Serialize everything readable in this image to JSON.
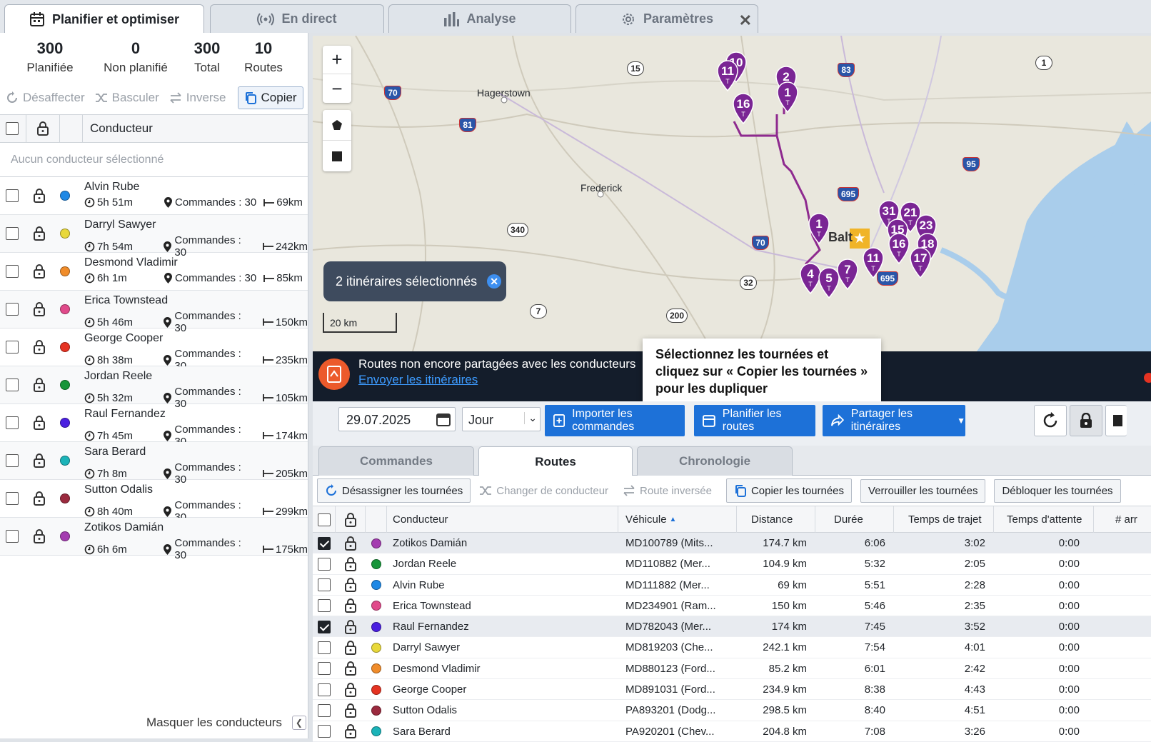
{
  "tabs": [
    {
      "label": "Planifier et optimiser",
      "icon": "calendar-icon",
      "active": true
    },
    {
      "label": "En direct",
      "icon": "broadcast-icon"
    },
    {
      "label": "Analyse",
      "icon": "bar-chart-icon"
    },
    {
      "label": "Paramètres",
      "icon": "gear-icon"
    }
  ],
  "stats": [
    {
      "value": "300",
      "label": "Planifiée"
    },
    {
      "value": "0",
      "label": "Non planifié"
    },
    {
      "value": "300",
      "label": "Total"
    },
    {
      "value": "10",
      "label": "Routes"
    }
  ],
  "left_toolbar": {
    "unassign": "Désaffecter",
    "switch": "Basculer",
    "reverse": "Inverse",
    "copy": "Copier"
  },
  "left_header": {
    "driver": "Conducteur"
  },
  "no_driver_selected": "Aucun conducteur sélectionné",
  "drivers": [
    {
      "name": "Alvin Rube",
      "color": "#1e88e5",
      "time": "5h 51m",
      "orders": "Commandes : 30",
      "distance": "69km"
    },
    {
      "name": "Darryl Sawyer",
      "color": "#e8d83a",
      "time": "7h 54m",
      "orders": "Commandes : 30",
      "distance": "242km"
    },
    {
      "name": "Desmond Vladimir",
      "color": "#f08c2a",
      "time": "6h 1m",
      "orders": "Commandes : 30",
      "distance": "85km"
    },
    {
      "name": "Erica Townstead",
      "color": "#e04a8a",
      "time": "5h 46m",
      "orders": "Commandes : 30",
      "distance": "150km"
    },
    {
      "name": "George Cooper",
      "color": "#e53322",
      "time": "8h 38m",
      "orders": "Commandes : 30",
      "distance": "235km"
    },
    {
      "name": "Jordan Reele",
      "color": "#17953a",
      "time": "5h 32m",
      "orders": "Commandes : 30",
      "distance": "105km"
    },
    {
      "name": "Raul Fernandez",
      "color": "#4a1fe0",
      "time": "7h 45m",
      "orders": "Commandes : 30",
      "distance": "174km"
    },
    {
      "name": "Sara Berard",
      "color": "#1bb3b8",
      "time": "7h 8m",
      "orders": "Commandes : 30",
      "distance": "205km"
    },
    {
      "name": "Sutton Odalis",
      "color": "#9b2a3e",
      "time": "8h 40m",
      "orders": "Commandes : 30",
      "distance": "299km"
    },
    {
      "name": "Zotikos Damián",
      "color": "#a43cb0",
      "time": "6h 6m",
      "orders": "Commandes : 30",
      "distance": "175km"
    }
  ],
  "hide_drivers": "Masquer les conducteurs",
  "map": {
    "selected_routes": "2 itinéraires sélectionnés",
    "scale": "20 km",
    "places": [
      "Hagerstown",
      "Frederick",
      "Balt"
    ],
    "highways": [
      "70",
      "81",
      "15",
      "83",
      "695",
      "340",
      "70",
      "32",
      "7",
      "200",
      "95",
      "695",
      "1"
    ],
    "pins": [
      "10",
      "11",
      "16",
      "2",
      "1",
      "1",
      "31",
      "21",
      "15",
      "23",
      "16",
      "18",
      "17",
      "11",
      "4",
      "5",
      "7"
    ],
    "pin_letter": "T"
  },
  "banner": {
    "text": "Routes non encore partagées avec les conducteurs",
    "link": "Envoyer les itinéraires"
  },
  "tooltip": "Sélectionnez les tournées et cliquez sur « Copier les tournées » pour les dupliquer",
  "controls": {
    "date": "29.07.2025",
    "period": "Jour",
    "import": "Importer les commandes",
    "plan": "Planifier les routes",
    "share": "Partager les itinéraires"
  },
  "subtabs": [
    "Commandes",
    "Routes",
    "Chronologie"
  ],
  "actions": {
    "unassign": "Désassigner les tournées",
    "change_driver": "Changer de conducteur",
    "reverse": "Route inversée",
    "copy": "Copier les tournées",
    "lock": "Verrouiller les tournées",
    "unlock": "Débloquer les tournées"
  },
  "table": {
    "headers": {
      "driver": "Conducteur",
      "vehicle": "Véhicule",
      "distance": "Distance",
      "duration": "Durée",
      "travel": "Temps de trajet",
      "wait": "Temps d'attente",
      "arrivals": "# arr"
    },
    "rows": [
      {
        "checked": true,
        "color": "#a43cb0",
        "driver": "Zotikos Damián",
        "vehicle": "MD100789 (Mits...",
        "distance": "174.7 km",
        "duration": "6:06",
        "travel": "3:02",
        "wait": "0:00"
      },
      {
        "checked": false,
        "color": "#17953a",
        "driver": "Jordan Reele",
        "vehicle": "MD110882 (Mer...",
        "distance": "104.9 km",
        "duration": "5:32",
        "travel": "2:05",
        "wait": "0:00"
      },
      {
        "checked": false,
        "color": "#1e88e5",
        "driver": "Alvin Rube",
        "vehicle": "MD111882 (Mer...",
        "distance": "69 km",
        "duration": "5:51",
        "travel": "2:28",
        "wait": "0:00"
      },
      {
        "checked": false,
        "color": "#e04a8a",
        "driver": "Erica Townstead",
        "vehicle": "MD234901 (Ram...",
        "distance": "150 km",
        "duration": "5:46",
        "travel": "2:35",
        "wait": "0:00"
      },
      {
        "checked": true,
        "color": "#4a1fe0",
        "driver": "Raul Fernandez",
        "vehicle": "MD782043 (Mer...",
        "distance": "174 km",
        "duration": "7:45",
        "travel": "3:52",
        "wait": "0:00"
      },
      {
        "checked": false,
        "color": "#e8d83a",
        "driver": "Darryl Sawyer",
        "vehicle": "MD819203 (Che...",
        "distance": "242.1 km",
        "duration": "7:54",
        "travel": "4:01",
        "wait": "0:00"
      },
      {
        "checked": false,
        "color": "#f08c2a",
        "driver": "Desmond Vladimir",
        "vehicle": "MD880123 (Ford...",
        "distance": "85.2 km",
        "duration": "6:01",
        "travel": "2:42",
        "wait": "0:00"
      },
      {
        "checked": false,
        "color": "#e53322",
        "driver": "George Cooper",
        "vehicle": "MD891031 (Ford...",
        "distance": "234.9 km",
        "duration": "8:38",
        "travel": "4:43",
        "wait": "0:00"
      },
      {
        "checked": false,
        "color": "#9b2a3e",
        "driver": "Sutton Odalis",
        "vehicle": "PA893201 (Dodg...",
        "distance": "298.5 km",
        "duration": "8:40",
        "travel": "4:51",
        "wait": "0:00"
      },
      {
        "checked": false,
        "color": "#1bb3b8",
        "driver": "Sara Berard",
        "vehicle": "PA920201 (Chev...",
        "distance": "204.8 km",
        "duration": "7:08",
        "travel": "3:26",
        "wait": "0:00"
      }
    ]
  }
}
